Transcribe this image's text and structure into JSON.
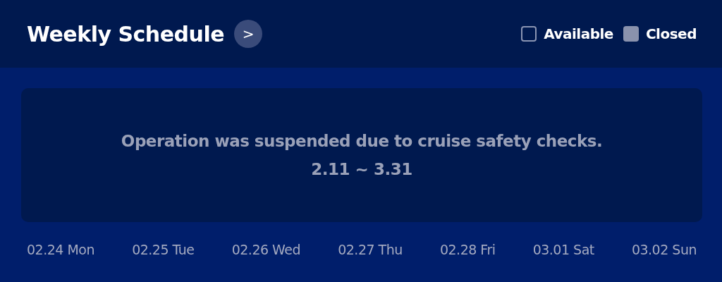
{
  "header": {
    "title": "Weekly Schedule",
    "more_button": ">"
  },
  "legend": [
    {
      "kind": "available",
      "label": "Available"
    },
    {
      "kind": "closed",
      "label": "Closed"
    }
  ],
  "notice": {
    "message": "Operation was suspended due to cruise safety checks.",
    "period": "2.11 ~ 3.31"
  },
  "days": [
    "02.24 Mon",
    "02.25 Tue",
    "02.26 Wed",
    "02.27 Thu",
    "02.28 Fri",
    "03.01 Sat",
    "03.02 Sun"
  ]
}
